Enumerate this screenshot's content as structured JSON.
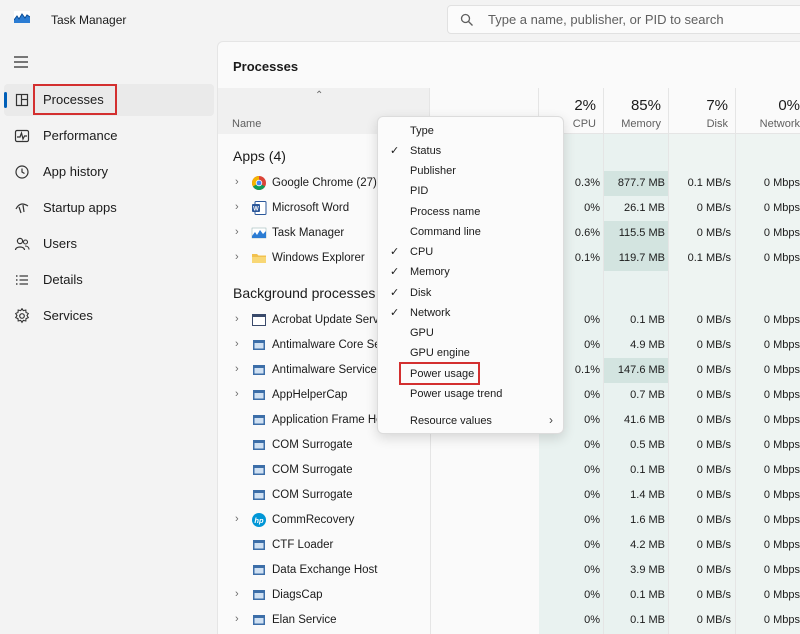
{
  "app": {
    "title": "Task Manager"
  },
  "search": {
    "placeholder": "Type a name, publisher, or PID to search"
  },
  "sidebar": {
    "items": [
      {
        "label": "Processes",
        "icon": "processes-icon",
        "active": true
      },
      {
        "label": "Performance",
        "icon": "performance-icon"
      },
      {
        "label": "App history",
        "icon": "history-icon"
      },
      {
        "label": "Startup apps",
        "icon": "startup-icon"
      },
      {
        "label": "Users",
        "icon": "users-icon"
      },
      {
        "label": "Details",
        "icon": "details-icon"
      },
      {
        "label": "Services",
        "icon": "services-icon"
      }
    ]
  },
  "main": {
    "title": "Processes",
    "columns": {
      "name": "Name",
      "cpu": {
        "pct": "2%",
        "label": "CPU"
      },
      "memory": {
        "pct": "85%",
        "label": "Memory"
      },
      "disk": {
        "pct": "7%",
        "label": "Disk"
      },
      "network": {
        "pct": "0%",
        "label": "Network"
      }
    },
    "apps_label": "Apps (4)",
    "bg_label": "Background processes",
    "apps": [
      {
        "name": "Google Chrome (27)",
        "cpu": "0.3%",
        "mem": "877.7 MB",
        "disk": "0.1 MB/s",
        "net": "0 Mbps"
      },
      {
        "name": "Microsoft Word",
        "cpu": "0%",
        "mem": "26.1 MB",
        "disk": "0 MB/s",
        "net": "0 Mbps"
      },
      {
        "name": "Task Manager",
        "cpu": "0.6%",
        "mem": "115.5 MB",
        "disk": "0 MB/s",
        "net": "0 Mbps"
      },
      {
        "name": "Windows Explorer",
        "cpu": "0.1%",
        "mem": "119.7 MB",
        "disk": "0.1 MB/s",
        "net": "0 Mbps"
      }
    ],
    "background": [
      {
        "name": "Acrobat Update Service",
        "cpu": "0%",
        "mem": "0.1 MB",
        "disk": "0 MB/s",
        "net": "0 Mbps"
      },
      {
        "name": "Antimalware Core Service",
        "cpu": "0%",
        "mem": "4.9 MB",
        "disk": "0 MB/s",
        "net": "0 Mbps"
      },
      {
        "name": "Antimalware Service Executable",
        "cpu": "0.1%",
        "mem": "147.6 MB",
        "disk": "0 MB/s",
        "net": "0 Mbps"
      },
      {
        "name": "AppHelperCap",
        "cpu": "0%",
        "mem": "0.7 MB",
        "disk": "0 MB/s",
        "net": "0 Mbps"
      },
      {
        "name": "Application Frame Host",
        "cpu": "0%",
        "mem": "41.6 MB",
        "disk": "0 MB/s",
        "net": "0 Mbps"
      },
      {
        "name": "COM Surrogate",
        "cpu": "0%",
        "mem": "0.5 MB",
        "disk": "0 MB/s",
        "net": "0 Mbps"
      },
      {
        "name": "COM Surrogate",
        "cpu": "0%",
        "mem": "0.1 MB",
        "disk": "0 MB/s",
        "net": "0 Mbps"
      },
      {
        "name": "COM Surrogate",
        "cpu": "0%",
        "mem": "1.4 MB",
        "disk": "0 MB/s",
        "net": "0 Mbps"
      },
      {
        "name": "CommRecovery",
        "cpu": "0%",
        "mem": "1.6 MB",
        "disk": "0 MB/s",
        "net": "0 Mbps"
      },
      {
        "name": "CTF Loader",
        "cpu": "0%",
        "mem": "4.2 MB",
        "disk": "0 MB/s",
        "net": "0 Mbps"
      },
      {
        "name": "Data Exchange Host",
        "cpu": "0%",
        "mem": "3.9 MB",
        "disk": "0 MB/s",
        "net": "0 Mbps"
      },
      {
        "name": "DiagsCap",
        "cpu": "0%",
        "mem": "0.1 MB",
        "disk": "0 MB/s",
        "net": "0 Mbps"
      },
      {
        "name": "Elan Service",
        "cpu": "0%",
        "mem": "0.1 MB",
        "disk": "0 MB/s",
        "net": "0 Mbps"
      }
    ]
  },
  "context_menu": {
    "items": [
      {
        "label": "Type",
        "checked": false
      },
      {
        "label": "Status",
        "checked": true
      },
      {
        "label": "Publisher",
        "checked": false
      },
      {
        "label": "PID",
        "checked": false
      },
      {
        "label": "Process name",
        "checked": false
      },
      {
        "label": "Command line",
        "checked": false
      },
      {
        "label": "CPU",
        "checked": true
      },
      {
        "label": "Memory",
        "checked": true
      },
      {
        "label": "Disk",
        "checked": true
      },
      {
        "label": "Network",
        "checked": true
      },
      {
        "label": "GPU",
        "checked": false
      },
      {
        "label": "GPU engine",
        "checked": false
      },
      {
        "label": "Power usage",
        "checked": false
      },
      {
        "label": "Power usage trend",
        "checked": false
      },
      {
        "label": "Resource values",
        "checked": false,
        "submenu": true
      }
    ],
    "check_glyph": "✓",
    "submenu_glyph": "›"
  },
  "glyphs": {
    "chevron": "›",
    "sort_up": "⌃"
  },
  "colors": {
    "highlight": "#d32f2f",
    "accent": "#005fb8"
  }
}
